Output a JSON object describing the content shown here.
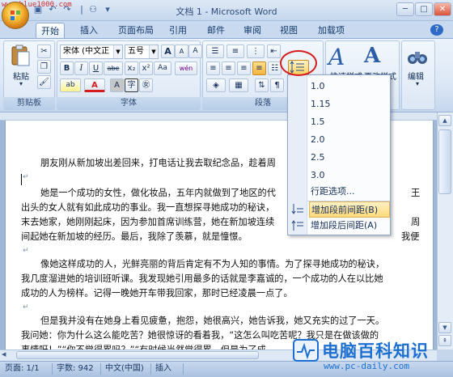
{
  "watermark_top": "www.blue1000.com",
  "window": {
    "title": "文档 1 - Microsoft Word"
  },
  "tabs": [
    "开始",
    "插入",
    "页面布局",
    "引用",
    "邮件",
    "审阅",
    "视图",
    "加载项"
  ],
  "ribbon": {
    "clipboard": {
      "paste_label": "粘贴",
      "group_label": "剪贴板"
    },
    "font": {
      "name": "宋体 (中文正",
      "size": "五号",
      "group_label": "字体",
      "grow": "A",
      "shrink": "A",
      "clear": "A",
      "wen": "wén",
      "bold": "B",
      "italic": "I",
      "underline": "U",
      "strike": "abe",
      "sub": "x₂",
      "sup": "x²",
      "aa": "Aa",
      "hl": "ab",
      "color": "A",
      "char_border": "A",
      "phonetic": "字",
      "enclosed": "㊛"
    },
    "paragraph": {
      "group_label": "段落"
    },
    "styles": {
      "quick": "快速样式",
      "change": "更改样式"
    },
    "editing": {
      "label": "编辑"
    }
  },
  "dropdown": {
    "items": [
      "1.0",
      "1.15",
      "1.5",
      "2.0",
      "2.5",
      "3.0"
    ],
    "options": "行距选项...",
    "add_before": "增加段前间距(B)",
    "add_after": "增加段后间距(A)"
  },
  "document": {
    "lines": [
      "朋友刚从新加坡出差回来，打电话让我去取纪念品，趁着周",
      "",
      "她是一个成功的女性，做化妆品，五年内就做到了地区的代",
      "出头的女人就有如此成功的事业。我一直想探寻她成功的秘诀，",
      "末去她家，她刚刚起床，因为参加首席训练营，她在新加坡连续",
      "间起她在新加坡的经历。最后，我除了羡慕，就是憧憬。",
      "",
      "像她这样成功的人，光鲜亮丽的背后肯定有不为人知的事情。为了探寻她成功的秘诀，",
      "我几度溜进她的培训班听课。我发现她引用最多的话就是李嘉诚的，一个成功的人在以比她",
      "成功的人为榜样。记得一晚她开车带我回家，那时已经凌晨一点了。",
      "",
      "但是我并没有在她身上看见疲惫，抱怨，她很高兴，她告诉我，她又充实的过了一天。",
      "我问她：你为什么这么能吃苦？她很惊讶的看着我，“这怎么叫吃苦呢？我只是在做该做的",
      "事情呀！”“你不觉得累吗？”“有时候当然觉得累，但是为了成"
    ],
    "right_fragments": [
      "王",
      "周",
      "我便"
    ]
  },
  "status": {
    "page": "页面: 1/1",
    "words": "字数: 942",
    "lang": "中文(中国)",
    "mode": "插入"
  },
  "brand": {
    "title": "电脑百科知识",
    "url": "www.pc-daily.com"
  },
  "colors": {
    "accent": "#1c6fd0",
    "circle": "#d51c1c",
    "ribbon": "#dde8f6"
  }
}
